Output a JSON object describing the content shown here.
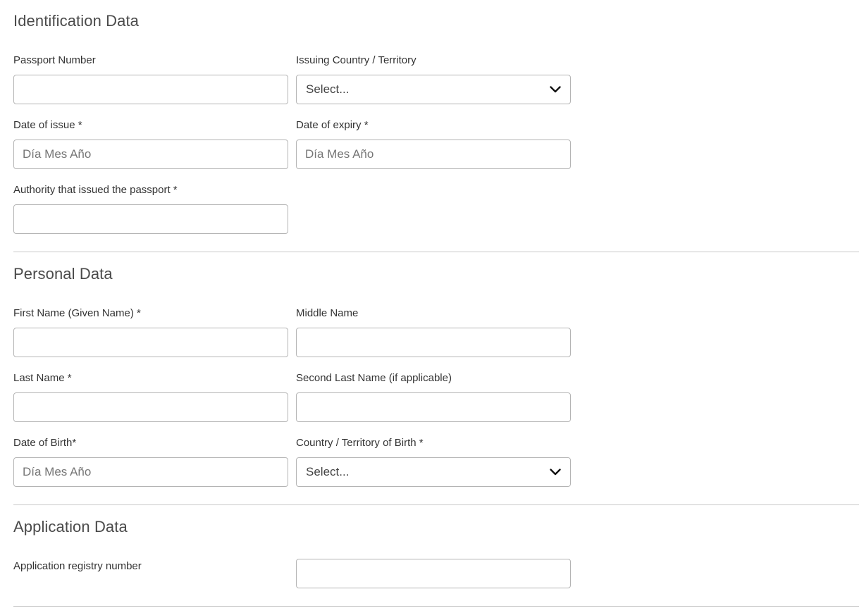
{
  "identification": {
    "title": "Identification Data",
    "passport_number": {
      "label": "Passport Number",
      "value": ""
    },
    "issuing_country": {
      "label": "Issuing Country / Territory",
      "selected": "Select..."
    },
    "date_of_issue": {
      "label": "Date of issue *",
      "placeholder": "Día Mes Año"
    },
    "date_of_expiry": {
      "label": "Date of expiry *",
      "placeholder": "Día Mes Año"
    },
    "issuing_authority": {
      "label": "Authority that issued the passport *",
      "value": ""
    }
  },
  "personal": {
    "title": "Personal Data",
    "first_name": {
      "label": "First Name (Given Name) *",
      "value": ""
    },
    "middle_name": {
      "label": "Middle Name",
      "value": ""
    },
    "last_name": {
      "label": "Last Name *",
      "value": ""
    },
    "second_last_name": {
      "label": "Second Last Name (if applicable)",
      "value": ""
    },
    "date_of_birth": {
      "label": "Date of Birth*",
      "placeholder": "Día Mes Año"
    },
    "country_of_birth": {
      "label": "Country / Territory of Birth *",
      "selected": "Select..."
    }
  },
  "application": {
    "title": "Application Data",
    "registry_number": {
      "label": "Application registry number",
      "value": ""
    }
  },
  "icons": {
    "select_arrow": "chevron-down-icon"
  },
  "colors": {
    "border": "#b4b4b4",
    "divider": "#c8c8c8",
    "text": "#333333",
    "placeholder": "#767676"
  }
}
